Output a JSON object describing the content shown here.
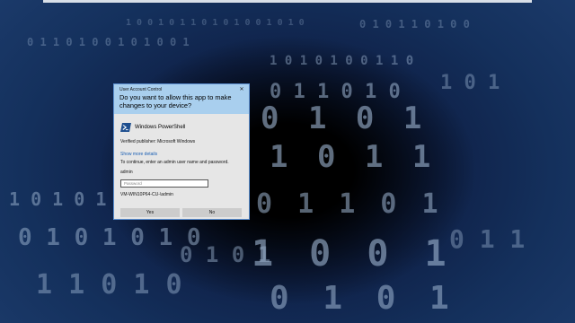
{
  "uac_dialog": {
    "caption": "User Account Control",
    "question": "Do you want to allow this app to make changes to your device?",
    "app_name": "Windows PowerShell",
    "publisher": "Verified publisher: Microsoft Windows",
    "details_link": "Show more details",
    "instructions": "To continue, enter an admin user name and password.",
    "username": "admin",
    "password_placeholder": "Password",
    "password_value": "",
    "domain_user": "VM-WIN10P64-CU-\\admin",
    "yes_label": "Yes",
    "no_label": "No"
  },
  "icons": {
    "close": "close-icon",
    "app": "powershell-icon"
  },
  "colors": {
    "header": "#a9cfee",
    "body": "#e6e6e6",
    "border": "#5b8fd1",
    "link": "#1a5fb4",
    "powershell": "#1f4f8f",
    "wallpaper": "#14305c"
  }
}
